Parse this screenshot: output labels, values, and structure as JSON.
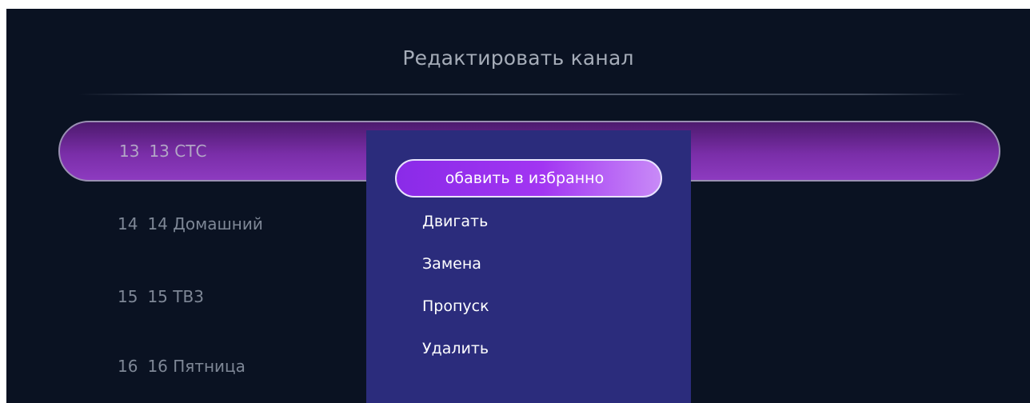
{
  "header": {
    "title": "Редактировать канал"
  },
  "channels": [
    {
      "number": "13",
      "name": "13 СТС",
      "selected": true
    },
    {
      "number": "14",
      "name": "14 Домашний",
      "selected": false
    },
    {
      "number": "15",
      "name": "15 ТВ3",
      "selected": false
    },
    {
      "number": "16",
      "name": "16 Пятница",
      "selected": false
    }
  ],
  "popup_menu": {
    "items": [
      {
        "label": "обавить в избранно",
        "focused": true
      },
      {
        "label": "Двигать",
        "focused": false
      },
      {
        "label": "Замена",
        "focused": false
      },
      {
        "label": "Пропуск",
        "focused": false
      },
      {
        "label": "Удалить",
        "focused": false
      }
    ]
  },
  "colors": {
    "background": "#0a1222",
    "selected_row": "#7a2ea8",
    "popup": "#2b2c7c",
    "focus": "#a235f2"
  }
}
